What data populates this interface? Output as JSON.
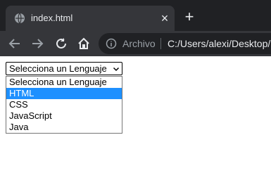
{
  "browser": {
    "tab_title": "index.html",
    "close_glyph": "×",
    "new_tab_glyph": "+",
    "omnibox_label": "Archivo",
    "url": "C:/Users/alexi/Desktop/"
  },
  "select": {
    "current_value": "Selecciona un Lenguaje",
    "options": [
      "Selecciona un Lenguaje",
      "HTML",
      "CSS",
      "JavaScript",
      "Java"
    ],
    "highlighted_option": "HTML"
  },
  "colors": {
    "highlight": "#1e90ff",
    "tabstrip": "#202124",
    "toolbar": "#35363a"
  },
  "icons": [
    "globe-icon",
    "back-arrow-icon",
    "forward-arrow-icon",
    "reload-icon",
    "home-icon",
    "info-icon",
    "chevron-down-icon"
  ]
}
